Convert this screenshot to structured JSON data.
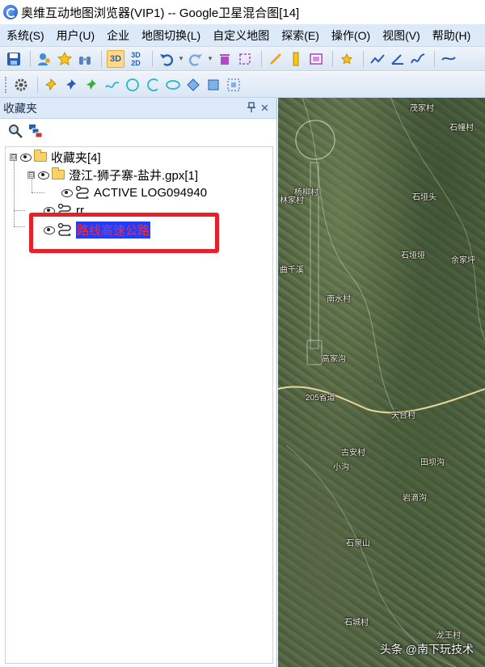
{
  "window": {
    "title": "奥维互动地图浏览器(VIP1) -- Google卫星混合图[14]"
  },
  "menu": [
    {
      "label": "系统(S)"
    },
    {
      "label": "用户(U)"
    },
    {
      "label": "企业"
    },
    {
      "label": "地图切换(L)"
    },
    {
      "label": "自定义地图"
    },
    {
      "label": "探索(E)"
    },
    {
      "label": "操作(O)"
    },
    {
      "label": "视图(V)"
    },
    {
      "label": "帮助(H)"
    }
  ],
  "toolbar": {
    "btn_3d": "3D",
    "btn_3d2d": "3D 2D",
    "active_button": "3D"
  },
  "panel": {
    "title": "收藏夹",
    "pin_glyph": "📌",
    "close_glyph": "✕"
  },
  "tree": {
    "root": {
      "label": "收藏夹[4]",
      "expander": "⊟"
    },
    "folder": {
      "label": "澄江-狮子寨-盐井.gpx[1]",
      "expander": "⊟"
    },
    "track1": {
      "label": "ACTIVE LOG094940"
    },
    "track2": {
      "label": "rr"
    },
    "track3": {
      "label": "路线高速公路"
    }
  },
  "map": {
    "labels": [
      {
        "text": "茂家村"
      },
      {
        "text": "杨柳村"
      },
      {
        "text": "石幢村"
      },
      {
        "text": "石垭头"
      },
      {
        "text": "林家村"
      },
      {
        "text": "石垭垭"
      },
      {
        "text": "余家坪"
      },
      {
        "text": "曲千溪"
      },
      {
        "text": "南水村"
      },
      {
        "text": "高家沟"
      },
      {
        "text": "205省道"
      },
      {
        "text": "天台村"
      },
      {
        "text": "古安村"
      },
      {
        "text": "小沟"
      },
      {
        "text": "田坝沟"
      },
      {
        "text": "岩滴沟"
      },
      {
        "text": "石泉山"
      },
      {
        "text": "石城村"
      },
      {
        "text": "龙王村"
      }
    ],
    "watermark": "头条 @南下玩技术"
  },
  "colors": {
    "selection_bg": "#1f3cff",
    "selection_text": "#ff2a2a",
    "highlight_border": "#e8202a",
    "menu_bg": "#dce9f8"
  }
}
